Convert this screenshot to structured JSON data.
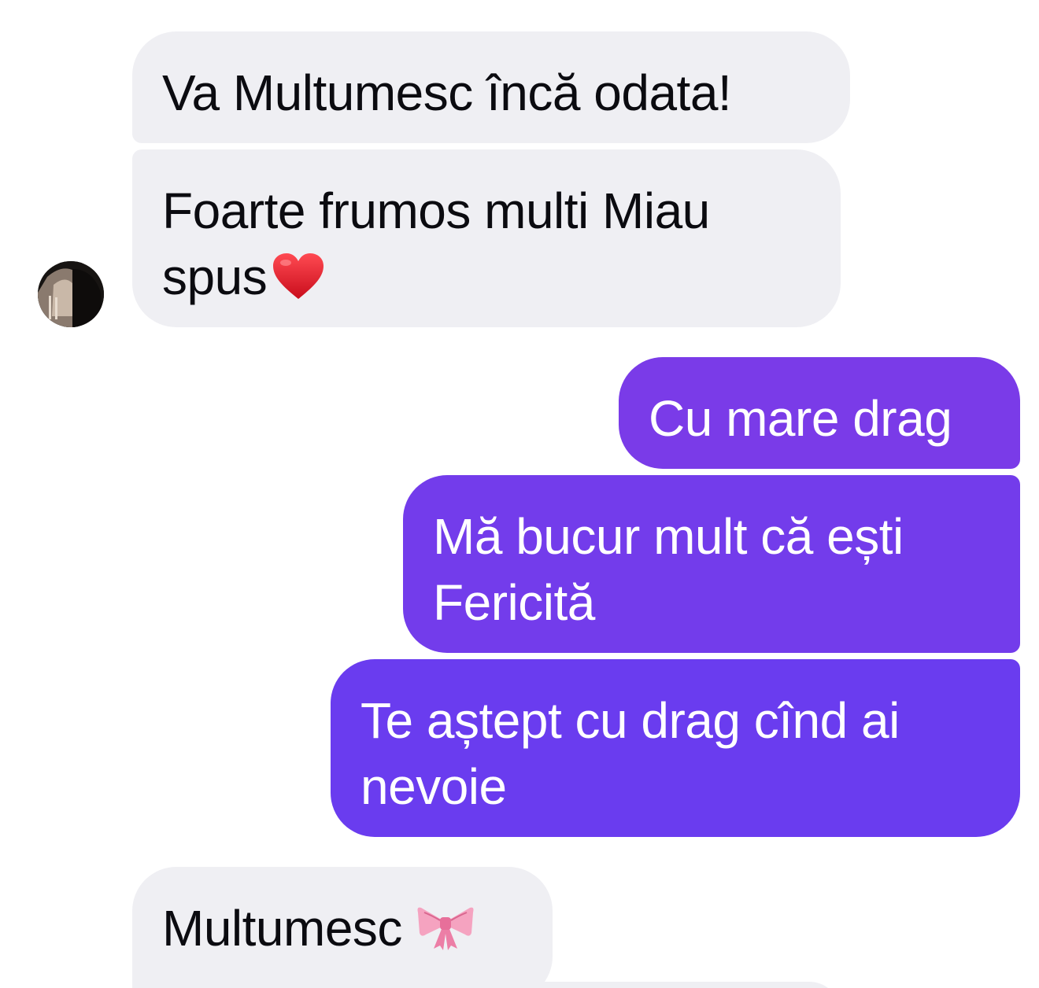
{
  "messages": {
    "in1": "Va Multumesc încă odata!",
    "in2": "Foarte frumos multi Miau spus",
    "in2_emoji": "heart-icon",
    "out1": "Cu mare drag",
    "out2": "Mă bucur mult că ești Fericită",
    "out3": "Te aștept cu drag cînd ai nevoie",
    "in3": "Multumesc",
    "in3_emoji": "ribbon-icon"
  },
  "colors": {
    "incoming_bubble": "#efeff3",
    "outgoing_bubble_1": "#7a3be8",
    "outgoing_bubble_2": "#733ceb",
    "outgoing_bubble_3": "#6a3cef",
    "incoming_text": "#0b0b10",
    "outgoing_text": "#ffffff"
  }
}
